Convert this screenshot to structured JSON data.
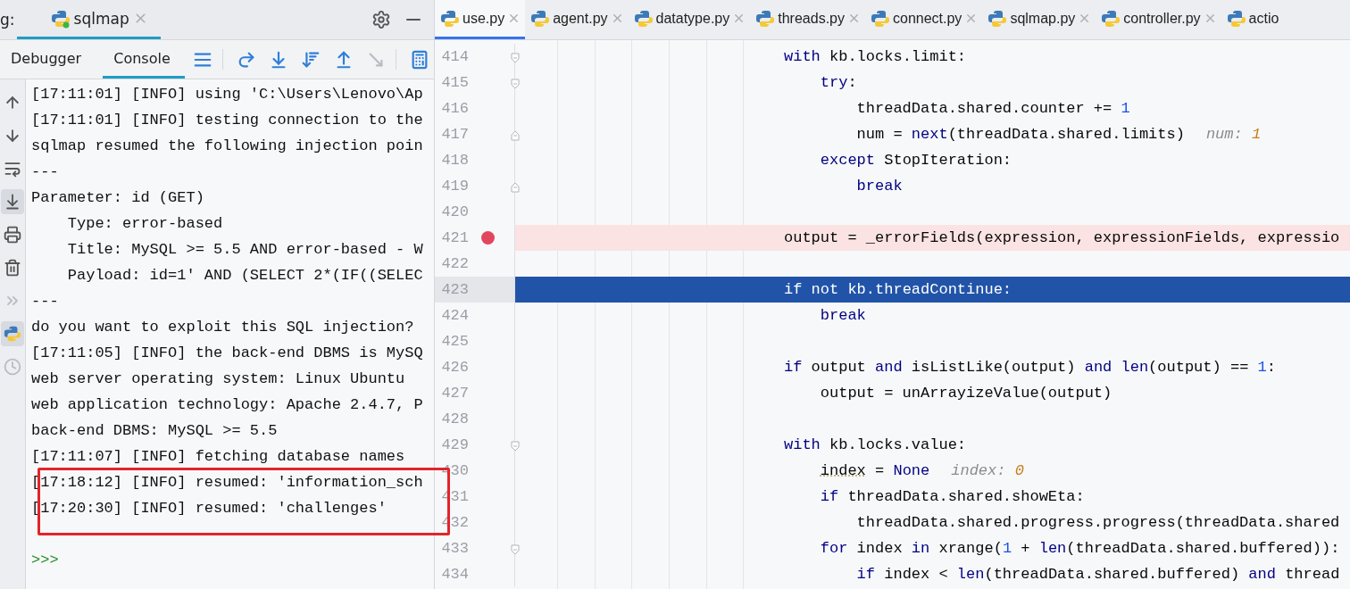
{
  "debug_header": {
    "label": "g:",
    "session_tab": {
      "label": "sqlmap",
      "selected": true
    }
  },
  "debug_tabs": [
    {
      "label": "Debugger",
      "selected": false
    },
    {
      "label": "Console",
      "selected": true
    }
  ],
  "console_toolbar": [
    {
      "disabled": false
    },
    {
      "disabled": false
    },
    {
      "disabled": false
    },
    {
      "disabled": false
    },
    {
      "disabled": false
    },
    {
      "disabled": true
    },
    {
      "disabled": false
    }
  ],
  "side_tools": [
    {
      "selected": false,
      "disabled": false
    },
    {
      "selected": false,
      "disabled": false
    },
    {
      "selected": false,
      "disabled": false
    },
    {
      "selected": true,
      "disabled": false
    },
    {
      "selected": false,
      "disabled": false
    },
    {
      "selected": false,
      "disabled": false
    },
    {
      "selected": false,
      "disabled": true
    },
    {
      "selected": true,
      "disabled": false
    },
    {
      "selected": false,
      "disabled": true
    }
  ],
  "console_lines": [
    {
      "kind": "output",
      "text": "[17:11:01] [INFO] using 'C:\\Users\\Lenovo\\Ap"
    },
    {
      "kind": "output",
      "text": "[17:11:01] [INFO] testing connection to the"
    },
    {
      "kind": "output",
      "text": "sqlmap resumed the following injection poin"
    },
    {
      "kind": "output",
      "text": "---"
    },
    {
      "kind": "output",
      "text": "Parameter: id (GET)"
    },
    {
      "kind": "output",
      "text": "    Type: error-based"
    },
    {
      "kind": "output",
      "text": "    Title: MySQL >= 5.5 AND error-based - W"
    },
    {
      "kind": "output",
      "text": "    Payload: id=1' AND (SELECT 2*(IF((SELEC"
    },
    {
      "kind": "output",
      "text": "---"
    },
    {
      "kind": "output",
      "text": "do you want to exploit this SQL injection?"
    },
    {
      "kind": "output",
      "text": "[17:11:05] [INFO] the back-end DBMS is MySQ"
    },
    {
      "kind": "output",
      "text": "web server operating system: Linux Ubuntu"
    },
    {
      "kind": "output",
      "text": "web application technology: Apache 2.4.7, P"
    },
    {
      "kind": "output",
      "text": "back-end DBMS: MySQL >= 5.5"
    },
    {
      "kind": "output",
      "text": "[17:11:07] [INFO] fetching database names"
    },
    {
      "kind": "output",
      "text": "[17:18:12] [INFO] resumed: 'information_sch"
    },
    {
      "kind": "output",
      "text": "[17:20:30] [INFO] resumed: 'challenges'"
    },
    {
      "kind": "blank"
    },
    {
      "kind": "prompt",
      "text": ">>>"
    }
  ],
  "annotation": {
    "kind": "rectangle"
  },
  "editor_tabs": [
    {
      "label": "use.py",
      "selected": true
    },
    {
      "label": "agent.py",
      "selected": false
    },
    {
      "label": "datatype.py",
      "selected": false
    },
    {
      "label": "threads.py",
      "selected": false
    },
    {
      "label": "connect.py",
      "selected": false
    },
    {
      "label": "sqlmap.py",
      "selected": false
    },
    {
      "label": "controller.py",
      "selected": false
    },
    {
      "label": "actio",
      "selected": false
    }
  ],
  "code_lines": [
    {
      "number": "414",
      "kind": "normal",
      "fold_start": true,
      "fold_end": false,
      "tokens": [
        {
          "kind": "keyword",
          "text": "with"
        },
        {
          "kind": "plain",
          "text": " kb.locks.limit:"
        }
      ]
    },
    {
      "number": "415",
      "kind": "normal",
      "fold_start": true,
      "fold_end": false,
      "tokens": [
        {
          "kind": "keyword",
          "text": "    try"
        },
        {
          "kind": "plain",
          "text": ":"
        }
      ]
    },
    {
      "number": "416",
      "kind": "normal",
      "fold_start": false,
      "fold_end": false,
      "tokens": [
        {
          "kind": "plain",
          "text": "        threadData.shared.counter += "
        },
        {
          "kind": "number",
          "text": "1"
        }
      ]
    },
    {
      "number": "417",
      "kind": "normal",
      "fold_start": false,
      "fold_end": true,
      "tokens": [
        {
          "kind": "plain",
          "text": "        num = "
        },
        {
          "kind": "keyword",
          "text": "next"
        },
        {
          "kind": "plain",
          "text": "(threadData.shared.limits)"
        }
      ],
      "hint": {
        "label": "num:",
        "value": "1"
      }
    },
    {
      "number": "418",
      "kind": "normal",
      "fold_start": false,
      "fold_end": false,
      "tokens": [
        {
          "kind": "keyword",
          "text": "    except"
        },
        {
          "kind": "plain",
          "text": " StopIteration:"
        }
      ]
    },
    {
      "number": "419",
      "kind": "normal",
      "fold_start": false,
      "fold_end": true,
      "tokens": [
        {
          "kind": "keyword",
          "text": "        break"
        }
      ]
    },
    {
      "number": "420",
      "kind": "normal",
      "fold_start": false,
      "fold_end": false
    },
    {
      "number": "421",
      "kind": "breakpoint",
      "fold_start": false,
      "fold_end": false,
      "tokens": [
        {
          "kind": "plain",
          "text": "output = _errorFields(expression, expressionFields, expressio"
        }
      ]
    },
    {
      "number": "422",
      "kind": "normal",
      "fold_start": false,
      "fold_end": false
    },
    {
      "number": "423",
      "kind": "current",
      "fold_start": false,
      "fold_end": false,
      "tokens": [
        {
          "kind": "keyword",
          "text": "if not"
        },
        {
          "kind": "plain",
          "text": " kb.threadContinue:"
        }
      ]
    },
    {
      "number": "424",
      "kind": "normal",
      "fold_start": false,
      "fold_end": false,
      "tokens": [
        {
          "kind": "keyword",
          "text": "    break"
        }
      ]
    },
    {
      "number": "425",
      "kind": "normal",
      "fold_start": false,
      "fold_end": false
    },
    {
      "number": "426",
      "kind": "normal",
      "fold_start": false,
      "fold_end": false,
      "tokens": [
        {
          "kind": "keyword",
          "text": "if"
        },
        {
          "kind": "plain",
          "text": " output "
        },
        {
          "kind": "keyword",
          "text": "and"
        },
        {
          "kind": "plain",
          "text": " isListLike(output) "
        },
        {
          "kind": "keyword",
          "text": "and len"
        },
        {
          "kind": "plain",
          "text": "(output) == "
        },
        {
          "kind": "number",
          "text": "1"
        },
        {
          "kind": "plain",
          "text": ":"
        }
      ]
    },
    {
      "number": "427",
      "kind": "normal",
      "fold_start": false,
      "fold_end": false,
      "tokens": [
        {
          "kind": "plain",
          "text": "    output = unArrayizeValue(output)"
        }
      ]
    },
    {
      "number": "428",
      "kind": "normal",
      "fold_start": false,
      "fold_end": false
    },
    {
      "number": "429",
      "kind": "normal",
      "fold_start": true,
      "fold_end": false,
      "tokens": [
        {
          "kind": "keyword",
          "text": "with"
        },
        {
          "kind": "plain",
          "text": " kb.locks.value:"
        }
      ]
    },
    {
      "number": "430",
      "kind": "normal",
      "fold_start": false,
      "fold_end": false,
      "tokens": [
        {
          "kind": "warning",
          "text": "    index"
        },
        {
          "kind": "plain",
          "text": " = "
        },
        {
          "kind": "keyword",
          "text": "None"
        }
      ],
      "hint": {
        "label": "index:",
        "value": "0"
      }
    },
    {
      "number": "431",
      "kind": "normal",
      "fold_start": false,
      "fold_end": false,
      "tokens": [
        {
          "kind": "keyword",
          "text": "    if"
        },
        {
          "kind": "plain",
          "text": " threadData.shared.showEta:"
        }
      ]
    },
    {
      "number": "432",
      "kind": "normal",
      "fold_start": false,
      "fold_end": false,
      "tokens": [
        {
          "kind": "plain",
          "text": "        threadData.shared.progress.progress(threadData.shared"
        }
      ]
    },
    {
      "number": "433",
      "kind": "normal",
      "fold_start": true,
      "fold_end": false,
      "tokens": [
        {
          "kind": "keyword",
          "text": "    for"
        },
        {
          "kind": "plain",
          "text": " index "
        },
        {
          "kind": "keyword",
          "text": "in"
        },
        {
          "kind": "plain",
          "text": " xrange("
        },
        {
          "kind": "number",
          "text": "1"
        },
        {
          "kind": "plain",
          "text": " + "
        },
        {
          "kind": "keyword",
          "text": "len"
        },
        {
          "kind": "plain",
          "text": "(threadData.shared.buffered)):"
        }
      ]
    },
    {
      "number": "434",
      "kind": "normal",
      "fold_start": false,
      "fold_end": false,
      "tokens": [
        {
          "kind": "keyword",
          "text": "        if"
        },
        {
          "kind": "plain",
          "text": " index < "
        },
        {
          "kind": "keyword",
          "text": "len"
        },
        {
          "kind": "plain",
          "text": "(threadData.shared.buffered) "
        },
        {
          "kind": "keyword",
          "text": "and"
        },
        {
          "kind": "plain",
          "text": " thread"
        }
      ]
    }
  ]
}
